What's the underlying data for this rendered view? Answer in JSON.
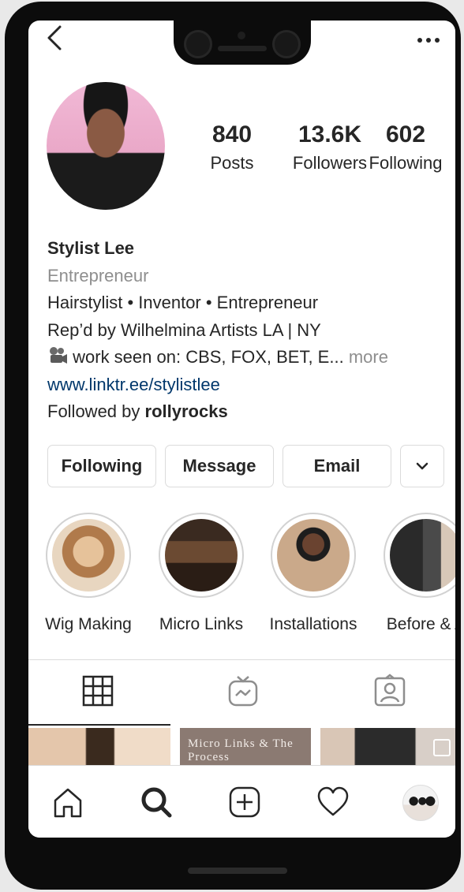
{
  "profile": {
    "stats": {
      "posts": {
        "value": "840",
        "label": "Posts"
      },
      "followers": {
        "value": "13.6K",
        "label": "Followers"
      },
      "following": {
        "value": "602",
        "label": "Following"
      }
    },
    "name": "Stylist Lee",
    "category": "Entrepreneur",
    "bio_line1": "Hairstylist • Inventor • Entrepreneur",
    "bio_line2": "Rep’d by Wilhelmina Artists LA | NY",
    "bio_line3": "work seen on: CBS, FOX, BET, E...",
    "bio_more": "more",
    "link": "www.linktr.ee/stylistlee",
    "followed_by_prefix": "Followed by",
    "followed_by_user": "rollyrocks"
  },
  "actions": {
    "following_label": "Following",
    "message_label": "Message",
    "email_label": "Email",
    "more_icon": "chevron-down-icon"
  },
  "highlights": [
    {
      "label": "Wig Making"
    },
    {
      "label": "Micro Links"
    },
    {
      "label": "Installations"
    },
    {
      "label": "Before & A"
    }
  ],
  "posts": {
    "post_1_text": "Micro Links & The Process"
  },
  "tabs": [
    "grid-icon",
    "igtv-icon",
    "tagged-icon"
  ],
  "nav": [
    "home-icon",
    "search-icon",
    "add-post-icon",
    "heart-icon",
    "profile-avatar"
  ],
  "colors": {
    "text": "#262626",
    "secondary": "#8e8e8e",
    "link": "#00376b",
    "border": "#dbdbdb"
  }
}
